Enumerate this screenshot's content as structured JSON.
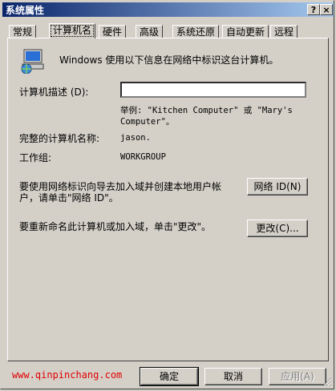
{
  "window": {
    "title": "系统属性",
    "help_glyph": "?",
    "close_glyph": "×"
  },
  "tabs": [
    {
      "label": "常规"
    },
    {
      "label": "计算机名"
    },
    {
      "label": "硬件"
    },
    {
      "label": "高级"
    },
    {
      "label": "系统还原"
    },
    {
      "label": "自动更新"
    },
    {
      "label": "远程"
    }
  ],
  "main": {
    "intro": "Windows 使用以下信息在网络中标识这台计算机。",
    "desc_label": "计算机描述 (D):",
    "desc_value": "",
    "example_line1": "举例: \"Kitchen Computer\" 或 \"Mary's",
    "example_line2": "Computer\"。",
    "fullname_label": "完整的计算机名称:",
    "fullname_value": "jason.",
    "workgroup_label": "工作组:",
    "workgroup_value": "WORKGROUP",
    "network_text_line1": "要使用网络标识向导去加入域并创建本地用户帐",
    "network_text_line2": "户，请单击\"网络 ID\"。",
    "network_button": "网络 ID(N)",
    "rename_text": "要重新命名此计算机或加入域，单击\"更改\"。",
    "change_button": "更改(C)..."
  },
  "footer": {
    "watermark": "www.qinpinchang.com",
    "ok": "确定",
    "cancel": "取消",
    "apply": "应用(A)"
  }
}
